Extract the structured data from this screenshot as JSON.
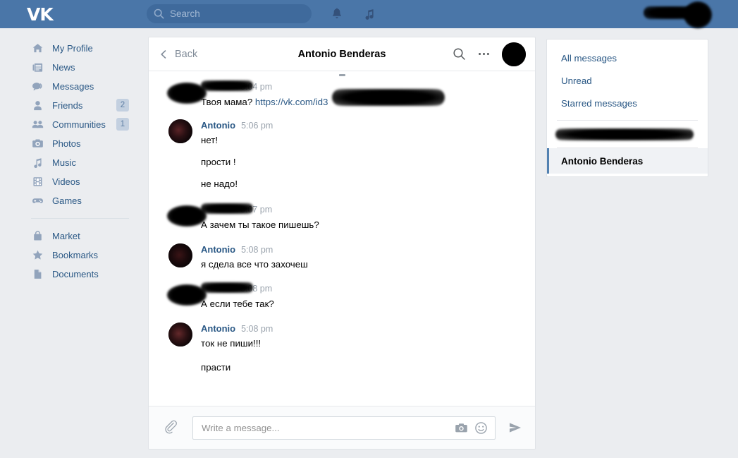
{
  "colors": {
    "header_blue": "#4a76a8",
    "link_blue": "#2a5885",
    "page_bg": "#ebedf0",
    "accent_selected": "#5281b1",
    "badge_bg": "#c3d0e0"
  },
  "topbar": {
    "logo": "VK",
    "search": {
      "placeholder": "Search",
      "value": "",
      "icon": "search-icon"
    },
    "icons": [
      {
        "name": "bell-icon",
        "label": "Notifications"
      },
      {
        "name": "music-note-icon",
        "label": "Music"
      }
    ],
    "user": {
      "name_redacted": true,
      "avatar_redacted": true
    }
  },
  "sidebar": {
    "items": [
      {
        "label": "My Profile",
        "icon": "home-icon",
        "badge": ""
      },
      {
        "label": "News",
        "icon": "news-icon",
        "badge": ""
      },
      {
        "label": "Messages",
        "icon": "chat-bubble-icon",
        "badge": ""
      },
      {
        "label": "Friends",
        "icon": "person-icon",
        "badge": "2"
      },
      {
        "label": "Communities",
        "icon": "people-icon",
        "badge": "1"
      },
      {
        "label": "Photos",
        "icon": "camera-icon",
        "badge": ""
      },
      {
        "label": "Music",
        "icon": "music-note-icon",
        "badge": ""
      },
      {
        "label": "Videos",
        "icon": "film-icon",
        "badge": ""
      },
      {
        "label": "Games",
        "icon": "gamepad-icon",
        "badge": ""
      }
    ],
    "items2": [
      {
        "label": "Market",
        "icon": "bag-icon",
        "badge": ""
      },
      {
        "label": "Bookmarks",
        "icon": "star-icon",
        "badge": ""
      },
      {
        "label": "Documents",
        "icon": "document-icon",
        "badge": ""
      }
    ]
  },
  "chat": {
    "back_label": "Back",
    "title": "Antonio Benderas",
    "header_icons": [
      {
        "name": "search-icon"
      },
      {
        "name": "more-options-icon"
      }
    ],
    "messages": [
      {
        "author": "",
        "author_redacted": true,
        "time": "5:04 pm",
        "avatar_redacted": true,
        "lines": [
          {
            "text": "Твоя мама? ",
            "link": "https://vk.com/id3",
            "link_redacted": true
          }
        ]
      },
      {
        "author": "Antonio",
        "author_redacted": false,
        "time": "5:06 pm",
        "avatar_redacted": false,
        "lines": [
          {
            "text": "нет!"
          },
          {
            "text": "прости !"
          },
          {
            "text": "не надо!"
          }
        ]
      },
      {
        "author": "",
        "author_redacted": true,
        "time": "5:07 pm",
        "avatar_redacted": true,
        "lines": [
          {
            "text": "А зачем ты такое пишешь?"
          }
        ]
      },
      {
        "author": "Antonio",
        "author_redacted": false,
        "time": "5:08 pm",
        "avatar_redacted": false,
        "lines": [
          {
            "text": "я сдела все что захочеш"
          }
        ]
      },
      {
        "author": "",
        "author_redacted": true,
        "time": "5:08 pm",
        "avatar_redacted": true,
        "lines": [
          {
            "text": "А если тебе так?"
          }
        ]
      },
      {
        "author": "Antonio",
        "author_redacted": false,
        "time": "5:08 pm",
        "avatar_redacted": false,
        "lines": [
          {
            "text": "ток не пиши!!!"
          },
          {
            "text": "прасти"
          }
        ]
      }
    ],
    "composer": {
      "attach_icon": "paperclip-icon",
      "placeholder": "Write a message...",
      "value": "",
      "camera_icon": "camera-icon",
      "emoji_icon": "smiley-icon",
      "send_icon": "send-icon"
    }
  },
  "right_panel": {
    "items": [
      {
        "label": "All messages"
      },
      {
        "label": "Unread"
      },
      {
        "label": "Starred messages"
      }
    ],
    "redacted_item": {
      "redacted": true
    },
    "selected": {
      "label": "Antonio Benderas"
    }
  }
}
